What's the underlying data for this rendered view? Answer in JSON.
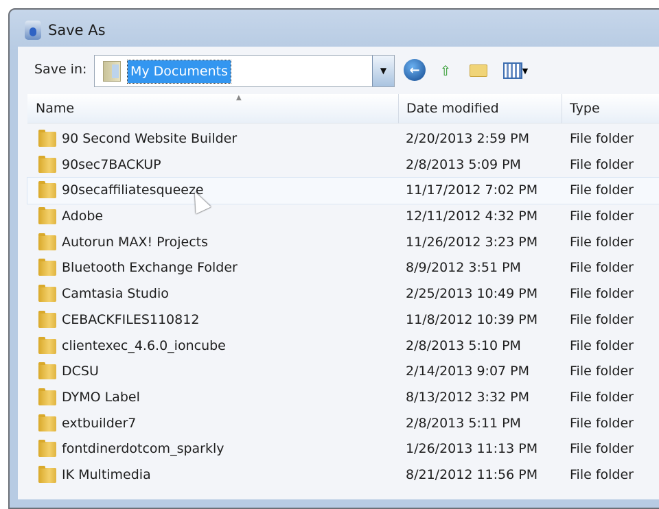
{
  "window": {
    "title": "Save As"
  },
  "toolbar": {
    "save_in_label": "Save in:",
    "location": "My Documents"
  },
  "columns": {
    "name": "Name",
    "date": "Date modified",
    "type": "Type"
  },
  "files": [
    {
      "name": "90 Second Website Builder",
      "date": "2/20/2013 2:59 PM",
      "type": "File folder"
    },
    {
      "name": "90sec7BACKUP",
      "date": "2/8/2013 5:09 PM",
      "type": "File folder"
    },
    {
      "name": "90secaffiliatesqueeze",
      "date": "11/17/2012 7:02 PM",
      "type": "File folder"
    },
    {
      "name": "Adobe",
      "date": "12/11/2012 4:32 PM",
      "type": "File folder"
    },
    {
      "name": "Autorun MAX! Projects",
      "date": "11/26/2012 3:23 PM",
      "type": "File folder"
    },
    {
      "name": "Bluetooth Exchange Folder",
      "date": "8/9/2012 3:51 PM",
      "type": "File folder"
    },
    {
      "name": "Camtasia Studio",
      "date": "2/25/2013 10:49 PM",
      "type": "File folder"
    },
    {
      "name": "CEBACKFILES110812",
      "date": "11/8/2012 10:39 PM",
      "type": "File folder"
    },
    {
      "name": "clientexec_4.6.0_ioncube",
      "date": "2/8/2013 5:10 PM",
      "type": "File folder"
    },
    {
      "name": "DCSU",
      "date": "2/14/2013 9:07 PM",
      "type": "File folder"
    },
    {
      "name": "DYMO Label",
      "date": "8/13/2012 3:32 PM",
      "type": "File folder"
    },
    {
      "name": "extbuilder7",
      "date": "2/8/2013 5:11 PM",
      "type": "File folder"
    },
    {
      "name": "fontdinerdotcom_sparkly",
      "date": "1/26/2013 11:13 PM",
      "type": "File folder"
    },
    {
      "name": "IK Multimedia",
      "date": "8/21/2012 11:56 PM",
      "type": "File folder"
    }
  ]
}
